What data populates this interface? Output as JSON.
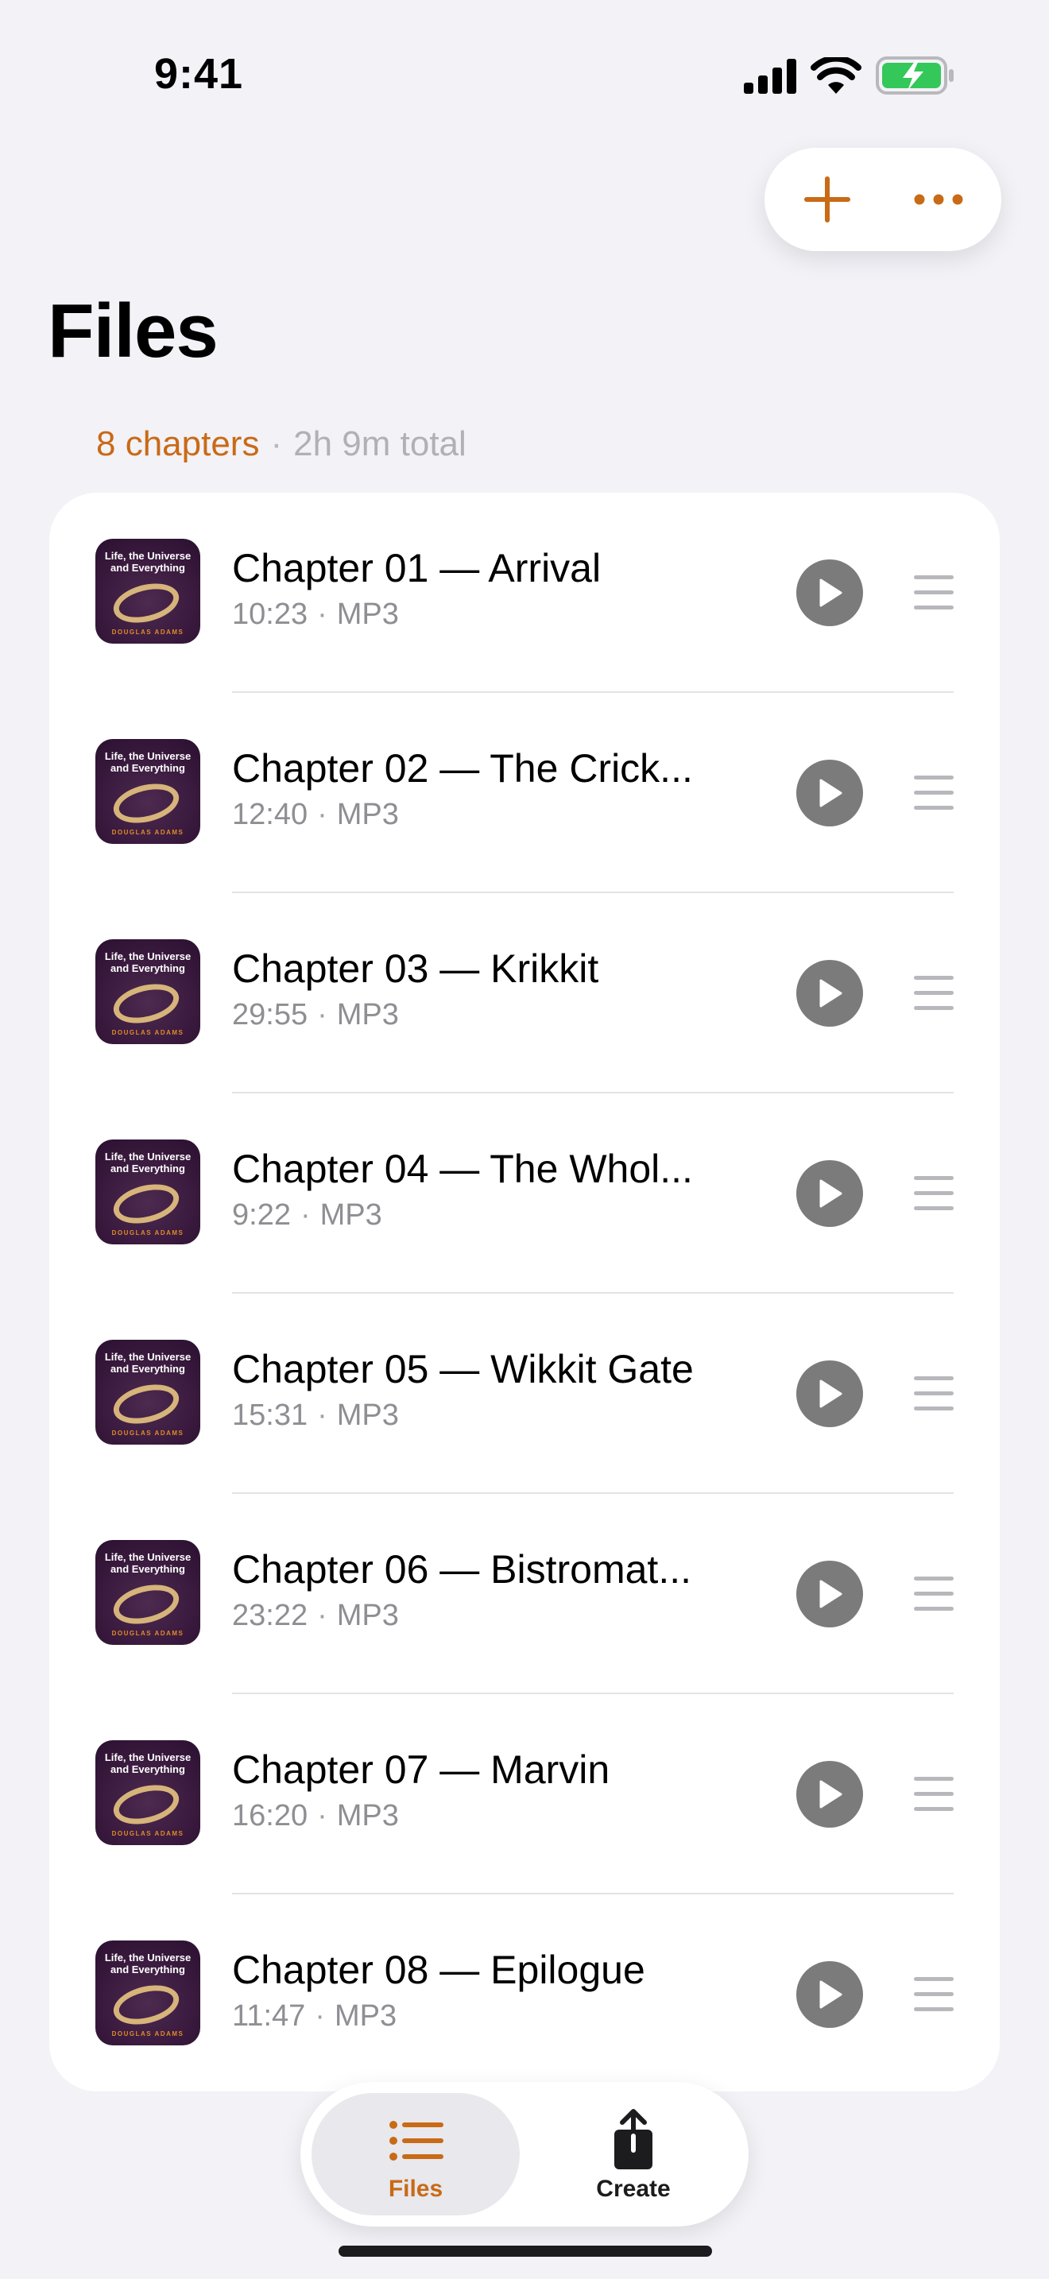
{
  "status_bar": {
    "time": "9:41",
    "icons": [
      "signal-bars-icon",
      "wifi-icon",
      "battery-charging-icon"
    ],
    "battery_color": "#34c759"
  },
  "toolbar": {
    "add_icon": "plus-icon",
    "more_icon": "ellipsis-icon",
    "accent_color": "#c96a16"
  },
  "header": {
    "title": "Files",
    "chapter_count": "8 chapters",
    "separator": "·",
    "total_duration": "2h 9m total"
  },
  "artwork": {
    "title": "Life, the Universe and Everything",
    "author": "DOUGLAS ADAMS"
  },
  "chapters": [
    {
      "title": "Chapter 01 — Arrival",
      "duration": "10:23",
      "format": "MP3"
    },
    {
      "title": "Chapter 02 — The Crick...",
      "duration": "12:40",
      "format": "MP3"
    },
    {
      "title": "Chapter 03 — Krikkit",
      "duration": "29:55",
      "format": "MP3"
    },
    {
      "title": "Chapter 04 — The Whol...",
      "duration": "9:22",
      "format": "MP3"
    },
    {
      "title": "Chapter 05 — Wikkit Gate",
      "duration": "15:31",
      "format": "MP3"
    },
    {
      "title": "Chapter 06 — Bistromat...",
      "duration": "23:22",
      "format": "MP3"
    },
    {
      "title": "Chapter 07 — Marvin",
      "duration": "16:20",
      "format": "MP3"
    },
    {
      "title": "Chapter 08 — Epilogue",
      "duration": "11:47",
      "format": "MP3"
    }
  ],
  "tab_bar": {
    "tabs": [
      {
        "label": "Files",
        "icon": "list-icon",
        "selected": true
      },
      {
        "label": "Create",
        "icon": "share-icon",
        "selected": false
      }
    ]
  }
}
